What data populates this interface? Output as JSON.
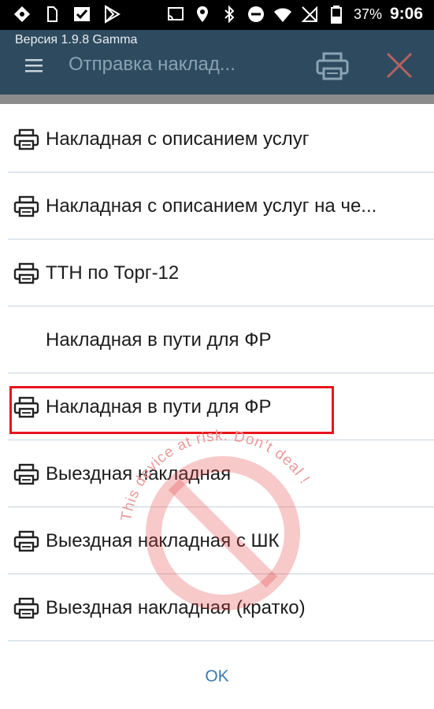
{
  "status_bar": {
    "left_icons": [
      "app-icon",
      "sim-icon",
      "checkbox-icon",
      "play-store-icon"
    ],
    "right_icons": [
      "cast-icon",
      "location-icon",
      "bluetooth-icon",
      "do-not-disturb-icon",
      "wifi-icon",
      "no-sim-icon",
      "battery-icon"
    ],
    "battery": "37%",
    "time": "9:06"
  },
  "app_bar": {
    "version": "Версия 1.9.8 Gamma",
    "title": "Отправка наклад...",
    "background": "#2e4a5e"
  },
  "list": {
    "items": [
      {
        "label": "Накладная с описанием услуг",
        "icon": "printer-icon"
      },
      {
        "label": "Накладная с описанием услуг на че...",
        "icon": "printer-icon"
      },
      {
        "label": "ТТН по Торг-12",
        "icon": "printer-icon"
      },
      {
        "label": "Накладная в пути для ФР",
        "icon": ""
      },
      {
        "label": "Накладная в пути для ФР",
        "icon": "printer-icon",
        "highlighted": true
      },
      {
        "label": "Выездная накладная",
        "icon": "printer-icon"
      },
      {
        "label": "Выездная накладная с ШК",
        "icon": "printer-icon"
      },
      {
        "label": "Выездная накладная (кратко)",
        "icon": "printer-icon"
      }
    ],
    "highlight_color": "#e8141c"
  },
  "dialog": {
    "ok_label": "OK",
    "accent": "#3b7bb6"
  },
  "watermark": {
    "text": "This device at risk. Don't deal !",
    "color": "#e23c3c"
  }
}
